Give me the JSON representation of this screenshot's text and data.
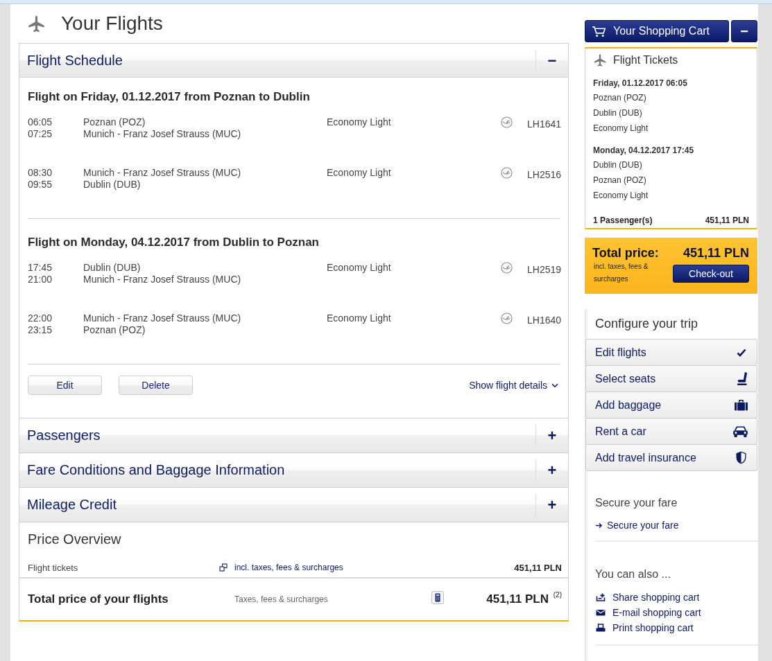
{
  "page": {
    "title": "Your Flights"
  },
  "sections": [
    {
      "title": "Flight Schedule",
      "toggle": "−",
      "expanded": true,
      "journeys": [
        {
          "heading": "Flight on Friday, 01.12.2017 from Poznan to Dublin",
          "segments": [
            {
              "departure": "06:05",
              "arrival": "07:25",
              "origin": "Poznan (POZ)",
              "destination": "Munich - Franz Josef Strauss (MUC)",
              "fare": "Economy Light",
              "flight": "LH1641"
            },
            {
              "departure": "08:30",
              "arrival": "09:55",
              "origin": "Munich - Franz Josef Strauss (MUC)",
              "destination": "Dublin (DUB)",
              "fare": "Economy Light",
              "flight": "LH2516"
            }
          ]
        },
        {
          "heading": "Flight on Monday, 04.12.2017 from Dublin to Poznan",
          "segments": [
            {
              "departure": "17:45",
              "arrival": "21:00",
              "origin": "Dublin (DUB)",
              "destination": "Munich - Franz Josef Strauss (MUC)",
              "fare": "Economy Light",
              "flight": "LH2519"
            },
            {
              "departure": "22:00",
              "arrival": "23:15",
              "origin": "Munich - Franz Josef Strauss (MUC)",
              "destination": "Poznan (POZ)",
              "fare": "Economy Light",
              "flight": "LH1640"
            }
          ]
        }
      ],
      "buttons": [
        "Edit",
        "Delete"
      ],
      "details_link": "Show flight details"
    },
    {
      "title": "Passengers",
      "toggle": "+",
      "expanded": false
    },
    {
      "title": "Fare Conditions and Baggage Information",
      "toggle": "+",
      "expanded": false
    },
    {
      "title": "Mileage Credit",
      "toggle": "+",
      "expanded": false
    }
  ],
  "price_overview": {
    "title": "Price Overview",
    "rows": [
      {
        "label": "Flight tickets",
        "link": "incl. taxes, fees & surcharges",
        "amount": "451,11 PLN"
      }
    ],
    "total": {
      "label": "Total price of your flights",
      "note": "Taxes, fees & surcharges",
      "amount": "451,11 PLN $^{(2)}$"
    }
  },
  "cart": {
    "button": "Your Shopping Cart",
    "toggle": "−",
    "title": "Flight Tickets",
    "journeys": [
      {
        "date": "Friday, 01.12.2017 06:05",
        "origin": "Poznan (POZ)",
        "destination": "Dublin (DUB)",
        "fare": "Economy Light"
      },
      {
        "date": "Monday, 04.12.2017 17:45",
        "origin": "Dublin (DUB)",
        "destination": "Poznan (POZ)",
        "fare": "Economy Light"
      }
    ],
    "passengers": "1 Passenger(s)",
    "amount": "451,11 PLN"
  },
  "total": {
    "label": "Total price:",
    "note": "incl. taxes, fees & surcharges",
    "amount": "451,11 PLN",
    "button": "Check-out"
  },
  "configure": {
    "title": "Configure your trip",
    "items": [
      {
        "label": "Edit flights",
        "kind": "check"
      },
      {
        "label": "Select seats",
        "kind": "seat"
      },
      {
        "label": "Add baggage",
        "kind": "baggage"
      },
      {
        "label": "Rent a car",
        "kind": "car"
      },
      {
        "label": "Add travel insurance",
        "kind": "insurance"
      }
    ]
  },
  "secure": {
    "title": "Secure your fare",
    "link": "Secure your fare"
  },
  "also": {
    "title": "You can also ...",
    "links": [
      {
        "label": "Share shopping cart",
        "kind": "share"
      },
      {
        "label": "E-mail shopping cart",
        "kind": "email"
      },
      {
        "label": "Print shopping cart",
        "kind": "print"
      }
    ]
  }
}
